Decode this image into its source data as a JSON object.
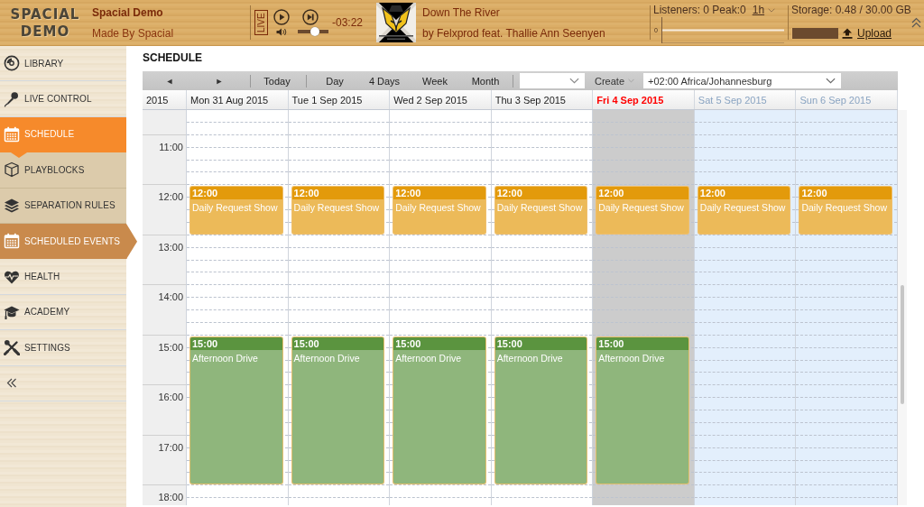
{
  "header": {
    "logo_lines": [
      "SPACIAL",
      "DEMO"
    ],
    "station": {
      "name": "Spacial Demo",
      "subtitle": "Made By Spacial"
    },
    "player": {
      "live_label": "LIVE",
      "volume": {
        "level": 0.6
      },
      "time_remaining": "-03:22"
    },
    "track": {
      "title": "Down The River",
      "artist": "by Felxprod feat. Thallie Ann Seenyen"
    },
    "listeners": {
      "label": "Listeners: 0 Peak:0",
      "range": "1h",
      "axis_label": "0"
    },
    "storage": {
      "label": "Storage: 0.48 / 30.00 GB",
      "level": 0.016,
      "upload_label": "Upload"
    }
  },
  "sidebar": {
    "items": [
      {
        "label": "LIBRARY",
        "selected": false
      },
      {
        "label": "LIVE CONTROL",
        "selected": false
      },
      {
        "label": "SCHEDULE",
        "selected": true,
        "expanded": true,
        "children": [
          {
            "label": "PLAYBLOCKS",
            "selected": false
          },
          {
            "label": "SEPARATION RULES",
            "selected": false
          },
          {
            "label": "SCHEDULED EVENTS",
            "selected": true
          }
        ]
      },
      {
        "label": "HEALTH",
        "selected": false
      },
      {
        "label": "ACADEMY",
        "selected": false
      },
      {
        "label": "SETTINGS",
        "selected": false
      }
    ]
  },
  "page": {
    "title": "SCHEDULE"
  },
  "toolbar": {
    "prev": "◄",
    "next": "►",
    "today": "Today",
    "views": [
      "Day",
      "4 Days",
      "Week",
      "Month"
    ],
    "create": "Create",
    "timezone": "+02:00 Africa/Johannesburg"
  },
  "calendar": {
    "year": "2015",
    "hours": [
      "11:00",
      "12:00",
      "13:00",
      "14:00",
      "15:00",
      "16:00",
      "17:00",
      "18:00"
    ],
    "days": [
      {
        "label": "Mon 31 Aug 2015",
        "kind": "weekday",
        "events": [
          {
            "kind": "short",
            "time": "12:00",
            "title": "Daily Request Show",
            "color": "#e39a0b"
          },
          {
            "kind": "long",
            "time": "15:00",
            "title": "Afternoon Drive",
            "color": "#5b943f"
          }
        ]
      },
      {
        "label": "Tue 1 Sep 2015",
        "kind": "weekday",
        "events": [
          {
            "kind": "short",
            "time": "12:00",
            "title": "Daily Request Show",
            "color": "#e39a0b"
          },
          {
            "kind": "long",
            "time": "15:00",
            "title": "Afternoon Drive",
            "color": "#5b943f"
          }
        ]
      },
      {
        "label": "Wed 2 Sep 2015",
        "kind": "weekday",
        "events": [
          {
            "kind": "short",
            "time": "12:00",
            "title": "Daily Request Show",
            "color": "#e39a0b"
          },
          {
            "kind": "long",
            "time": "15:00",
            "title": "Afternoon Drive",
            "color": "#5b943f"
          }
        ]
      },
      {
        "label": "Thu 3 Sep 2015",
        "kind": "weekday",
        "events": [
          {
            "kind": "short",
            "time": "12:00",
            "title": "Daily Request Show",
            "color": "#e39a0b"
          },
          {
            "kind": "long",
            "time": "15:00",
            "title": "Afternoon Drive",
            "color": "#5b943f"
          }
        ]
      },
      {
        "label": "Fri 4 Sep 2015",
        "kind": "today",
        "events": [
          {
            "kind": "short",
            "time": "12:00",
            "title": "Daily Request Show",
            "color": "#e39a0b"
          },
          {
            "kind": "long",
            "time": "15:00",
            "title": "Afternoon Drive",
            "color": "#5b943f"
          }
        ]
      },
      {
        "label": "Sat 5 Sep 2015",
        "kind": "weekend",
        "events": [
          {
            "kind": "short",
            "time": "12:00",
            "title": "Daily Request Show",
            "color": "#e39a0b"
          }
        ]
      },
      {
        "label": "Sun 6 Sep 2015",
        "kind": "weekend",
        "events": [
          {
            "kind": "short",
            "time": "12:00",
            "title": "Daily Request Show",
            "color": "#e39a0b"
          }
        ]
      }
    ]
  }
}
